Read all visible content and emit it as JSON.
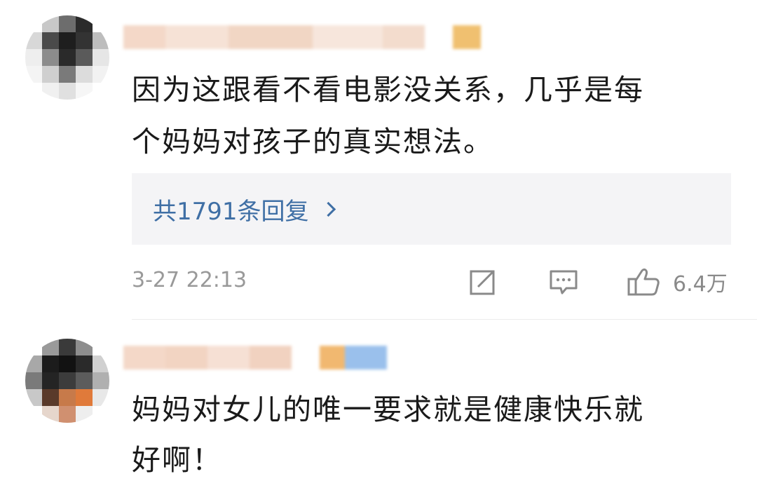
{
  "comments": [
    {
      "text_line1": "因为这跟看不看电影没关系，几乎是每",
      "text_line2": "个妈妈对孩子的真实想法。",
      "reply_link": "共1791条回复",
      "timestamp": "3-27 22:13",
      "like_count": "6.4万"
    },
    {
      "text_line1": "妈妈对女儿的唯一要求就是健康快乐就",
      "text_line2": "好啊！"
    }
  ],
  "colors": {
    "reply_link": "#3f6fa5",
    "reply_box_bg": "#f4f4f6",
    "meta_gray": "#999999",
    "text": "#1a1a1a"
  },
  "icons": {
    "share": "share-icon",
    "comment": "comment-icon",
    "like": "thumbs-up-icon",
    "chevron": "chevron-right-icon"
  }
}
